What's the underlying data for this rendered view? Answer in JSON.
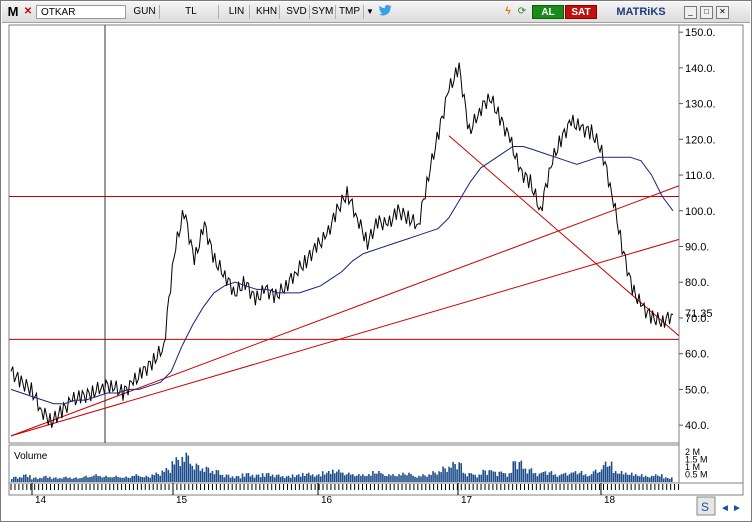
{
  "toolbar": {
    "app_icon": "M",
    "symbol": "OTKAR",
    "period": "GUN",
    "currency": "TL",
    "scale": "LIN",
    "khn": "KHN",
    "svd": "SVD",
    "sym": "SYM",
    "tmp": "TMP",
    "buy_label": "AL",
    "sell_label": "SAT",
    "brand": "MATRiKS",
    "icons": [
      "close-icon",
      "dropdown-icon",
      "twitter-icon",
      "bolt-icon",
      "refresh-icon",
      "minimize-icon",
      "maximize-icon",
      "close-window-icon"
    ]
  },
  "chart_data": {
    "type": "line",
    "title": "",
    "price_axis": {
      "ticks": [
        150,
        140,
        130,
        120,
        110,
        100,
        90,
        80,
        70,
        60,
        50,
        40
      ],
      "range": [
        35,
        152
      ],
      "last_value_label": "71.35",
      "last_value": 71.35
    },
    "x_labels": [
      "14",
      "15",
      "16",
      "17",
      "18"
    ],
    "volume_panel": {
      "label": "Volume",
      "ticks": [
        "2 M",
        "1.5 M",
        "1 M",
        "0.5 M"
      ]
    },
    "series": [
      {
        "name": "",
        "color": "#000000",
        "kind": "price",
        "values": [
          55,
          52,
          50,
          44,
          41,
          44,
          47,
          48,
          49,
          51,
          51,
          49,
          52,
          55,
          58,
          62,
          88,
          100,
          86,
          96,
          86,
          82,
          77,
          80,
          75,
          78,
          76,
          79,
          83,
          86,
          90,
          93,
          100,
          105,
          98,
          91,
          97,
          96,
          100,
          98,
          96,
          110,
          122,
          134,
          140,
          122,
          128,
          132,
          126,
          120,
          111,
          108,
          100,
          113,
          120,
          125,
          123,
          122,
          117,
          105,
          90,
          78,
          73,
          70,
          69,
          71
        ]
      },
      {
        "name": "",
        "color": "#1a237e",
        "kind": "moving-average",
        "values": [
          50,
          49,
          48,
          47,
          46,
          46,
          47,
          47,
          48,
          49,
          49,
          50,
          50,
          51,
          52,
          55,
          62,
          68,
          73,
          77,
          79,
          80,
          79,
          78,
          78,
          77,
          77,
          77,
          78,
          79,
          81,
          83,
          86,
          88,
          89,
          90,
          91,
          92,
          93,
          94,
          95,
          98,
          103,
          108,
          112,
          114,
          116,
          118,
          118,
          117,
          116,
          115,
          114,
          113,
          114,
          115,
          115,
          115,
          115,
          114,
          110,
          104,
          100
        ]
      },
      {
        "name": "",
        "kind": "volume",
        "color": "#1f4e8c",
        "values": [
          0.35,
          0.5,
          0.3,
          0.4,
          0.3,
          0.35,
          0.3,
          0.4,
          0.5,
          0.4,
          0.4,
          0.35,
          0.5,
          0.4,
          0.6,
          0.9,
          1.6,
          1.9,
          1.2,
          1.0,
          0.8,
          0.5,
          0.4,
          0.6,
          0.5,
          0.6,
          0.5,
          0.4,
          0.5,
          0.6,
          0.5,
          0.7,
          0.8,
          0.6,
          0.5,
          0.5,
          0.7,
          0.5,
          0.5,
          0.6,
          0.4,
          0.5,
          0.7,
          1.0,
          1.3,
          0.6,
          0.5,
          0.8,
          0.7,
          0.6,
          1.4,
          0.9,
          0.6,
          0.7,
          0.5,
          0.6,
          0.7,
          0.5,
          0.8,
          1.3,
          0.7,
          0.6,
          0.5,
          0.4,
          0.5,
          0.3
        ]
      }
    ],
    "horizontal_lines": [
      104,
      64
    ],
    "vertical_cursor_label": "14",
    "colors": {
      "trendline": "#cc0000",
      "price": "#000000",
      "average": "#1a237e",
      "volume": "#1f4e8c"
    }
  },
  "scroll": {
    "left_label": "◄",
    "right_label": "►"
  }
}
